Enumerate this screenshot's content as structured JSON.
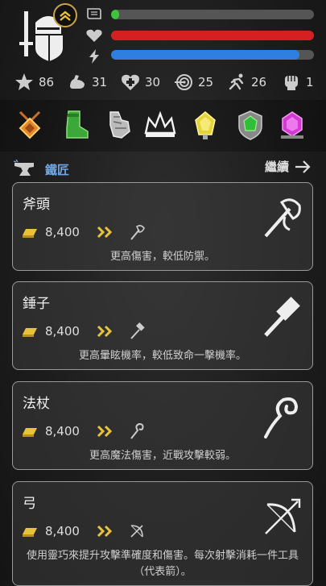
{
  "stats": [
    {
      "icon": "star-icon",
      "value": "86"
    },
    {
      "icon": "strength-icon",
      "value": "31"
    },
    {
      "icon": "health-plus-icon",
      "value": "30"
    },
    {
      "icon": "target-icon",
      "value": "25"
    },
    {
      "icon": "agility-icon",
      "value": "26"
    },
    {
      "icon": "fist-icon",
      "value": "1"
    }
  ],
  "bars": {
    "experience": 0.04,
    "health": 1.0,
    "mana": 0.93
  },
  "colors": {
    "experience": "#3cc43c",
    "health": "#d42020",
    "mana": "#2f7fe0",
    "accent": "#6fa8e6",
    "gold": "#e8c23a"
  },
  "section": {
    "title": "鐵匠",
    "continue_label": "繼續"
  },
  "items": [
    {
      "name": "斧頭",
      "price": "8,400",
      "desc": "更高傷害，較低防禦。",
      "icon": "axe-icon"
    },
    {
      "name": "錘子",
      "price": "8,400",
      "desc": "更高暈眩機率，較低致命一擊機率。",
      "icon": "hammer-icon"
    },
    {
      "name": "法杖",
      "price": "8,400",
      "desc": "更高魔法傷害，近戰攻擊較弱。",
      "icon": "staff-icon"
    },
    {
      "name": "弓",
      "price": "8,400",
      "desc": "使用靈巧來提升攻擊準確度和傷害。每次射擊消耗一件工具（代表箭）。",
      "icon": "bow-icon"
    }
  ]
}
